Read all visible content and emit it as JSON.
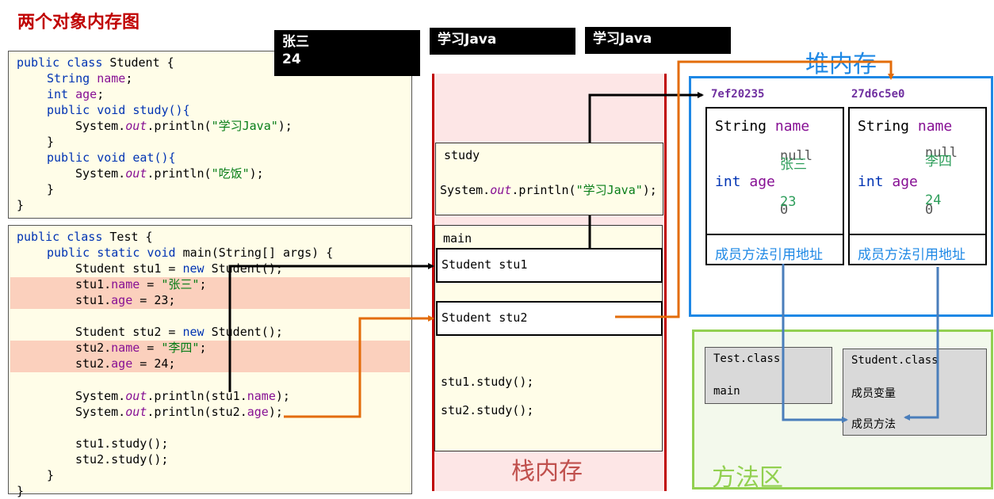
{
  "title": "两个对象内存图",
  "class_student": {
    "l1": [
      "public class ",
      "Student {"
    ],
    "l2": [
      "String ",
      "name",
      ";"
    ],
    "l3": [
      "int ",
      "age",
      ";"
    ],
    "l4": [
      "public void ",
      "study(){"
    ],
    "l5": [
      "System.",
      "out",
      ".println(",
      "\"学习Java\"",
      ");"
    ],
    "l6": "}",
    "l7": [
      "public void ",
      "eat(){"
    ],
    "l8": [
      "System.",
      "out",
      ".println(",
      "\"吃饭\"",
      ");"
    ],
    "l9": "}",
    "l10": "}"
  },
  "class_test": {
    "l1": [
      "public class ",
      "Test {"
    ],
    "l2": [
      "public static void ",
      "main(String[] args) {"
    ],
    "l3": [
      "Student stu1 = ",
      "new ",
      "Student();"
    ],
    "l4": [
      "stu1.",
      "name",
      " = ",
      "\"张三\"",
      ";"
    ],
    "l5": [
      "stu1.",
      "age",
      " = 23;"
    ],
    "l6": [
      "Student stu2 = ",
      "new ",
      "Student();"
    ],
    "l7": [
      "stu2.",
      "name",
      " = ",
      "\"李四\"",
      ";"
    ],
    "l8": [
      "stu2.",
      "age",
      " = 24;"
    ],
    "l9": [
      "System.",
      "out",
      ".println(stu1.",
      "name",
      ");"
    ],
    "l10": [
      "System.",
      "out",
      ".println(stu2.",
      "age",
      ");"
    ],
    "l11": "stu1.study();",
    "l12": "stu2.study();",
    "l13": "}",
    "l14": "}"
  },
  "console": {
    "box1_line1": "张三",
    "box1_line2": "24",
    "box2": "学习Java",
    "box3": "学习Java"
  },
  "stack": {
    "title": "栈内存",
    "study_frame": {
      "label": "study",
      "code": [
        "System.",
        "out",
        ".println(",
        "\"学习Java\"",
        ");"
      ]
    },
    "main_frame": {
      "label": "main",
      "slot1": "Student stu1",
      "slot2": "Student stu2",
      "call1": "stu1.study();",
      "call2": "stu2.study();"
    }
  },
  "heap": {
    "title": "堆内存",
    "objects": [
      {
        "address": "7ef20235",
        "name_type": "String ",
        "name_field": "name",
        "name_default": "null",
        "name_value": "张三",
        "age_type": "int ",
        "age_field": "age",
        "age_default": "0",
        "age_value": "23",
        "method_ref": "成员方法引用地址"
      },
      {
        "address": "27d6c5e0",
        "name_type": "String ",
        "name_field": "name",
        "name_default": "null",
        "name_value": "李四",
        "age_type": "int ",
        "age_field": "age",
        "age_default": "0",
        "age_value": "24",
        "method_ref": "成员方法引用地址"
      }
    ]
  },
  "method_area": {
    "title": "方法区",
    "test_class": {
      "name": "Test.class",
      "member": "main"
    },
    "student_class": {
      "name": "Student.class",
      "fields": "成员变量",
      "methods": "成员方法"
    }
  },
  "colors": {
    "title_red": "#c00000",
    "stack_border": "#c00000",
    "heap_border": "#1e88e5",
    "method_border": "#92d050",
    "arrow_black": "#000000",
    "arrow_orange": "#e36c0a",
    "arrow_blue": "#4a7ebb"
  }
}
